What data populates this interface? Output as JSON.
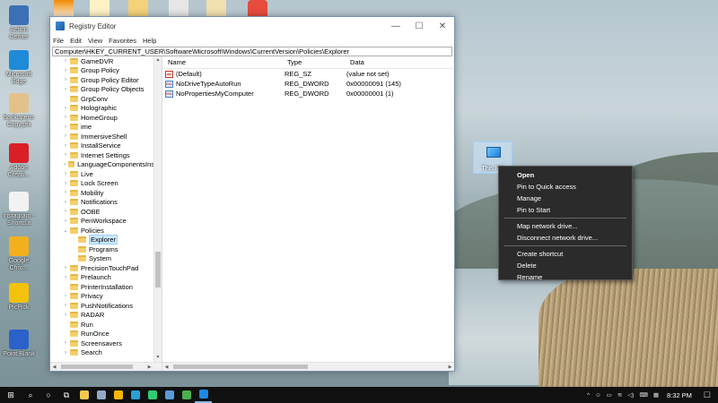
{
  "window": {
    "title": "Registry Editor",
    "controls": {
      "minimize": "—",
      "maximize": "☐",
      "close": "✕"
    },
    "menu": [
      "File",
      "Edit",
      "View",
      "Favorites",
      "Help"
    ],
    "address": "Computer\\HKEY_CURRENT_USER\\Software\\Microsoft\\Windows\\CurrentVersion\\Policies\\Explorer"
  },
  "tree": {
    "items": [
      {
        "label": "GameDVR",
        "level": 0,
        "expander": "›"
      },
      {
        "label": "Group Policy",
        "level": 0,
        "expander": "›"
      },
      {
        "label": "Group Policy Editor",
        "level": 0,
        "expander": "›"
      },
      {
        "label": "Group Policy Objects",
        "level": 0,
        "expander": "›"
      },
      {
        "label": "GrpConv",
        "level": 0,
        "expander": ""
      },
      {
        "label": "Holographic",
        "level": 0,
        "expander": "›"
      },
      {
        "label": "HomeGroup",
        "level": 0,
        "expander": "›"
      },
      {
        "label": "ime",
        "level": 0,
        "expander": "›"
      },
      {
        "label": "ImmersiveShell",
        "level": 0,
        "expander": "›"
      },
      {
        "label": "InstallService",
        "level": 0,
        "expander": "›"
      },
      {
        "label": "Internet Settings",
        "level": 0,
        "expander": "›"
      },
      {
        "label": "LanguageComponentsIns",
        "level": 0,
        "expander": "›"
      },
      {
        "label": "Live",
        "level": 0,
        "expander": "›"
      },
      {
        "label": "Lock Screen",
        "level": 0,
        "expander": "›"
      },
      {
        "label": "Mobility",
        "level": 0,
        "expander": "›"
      },
      {
        "label": "Notifications",
        "level": 0,
        "expander": "›"
      },
      {
        "label": "OOBE",
        "level": 0,
        "expander": "›"
      },
      {
        "label": "PenWorkspace",
        "level": 0,
        "expander": "›"
      },
      {
        "label": "Policies",
        "level": 0,
        "expander": "⌄"
      },
      {
        "label": "Explorer",
        "level": 1,
        "expander": "",
        "selected": true
      },
      {
        "label": "Programs",
        "level": 1,
        "expander": ""
      },
      {
        "label": "System",
        "level": 1,
        "expander": ""
      },
      {
        "label": "PrecisionTouchPad",
        "level": 0,
        "expander": "›"
      },
      {
        "label": "Prelaunch",
        "level": 0,
        "expander": "›"
      },
      {
        "label": "PrinterInstallation",
        "level": 0,
        "expander": ""
      },
      {
        "label": "Privacy",
        "level": 0,
        "expander": "›"
      },
      {
        "label": "PushNotifications",
        "level": 0,
        "expander": "›"
      },
      {
        "label": "RADAR",
        "level": 0,
        "expander": "›"
      },
      {
        "label": "Run",
        "level": 0,
        "expander": ""
      },
      {
        "label": "RunOnce",
        "level": 0,
        "expander": ""
      },
      {
        "label": "Screensavers",
        "level": 0,
        "expander": "›"
      },
      {
        "label": "Search",
        "level": 0,
        "expander": "›"
      }
    ],
    "scroll_arrows": {
      "up": "▲",
      "down": "▼",
      "left": "◀",
      "right": "▶"
    }
  },
  "values": {
    "columns": {
      "name": "Name",
      "type": "Type",
      "data": "Data"
    },
    "rows": [
      {
        "name": "(Default)",
        "type": "REG_SZ",
        "data": "(value not set)",
        "icon": "ab"
      },
      {
        "name": "NoDriveTypeAutoRun",
        "type": "REG_DWORD",
        "data": "0x00000091 (145)",
        "icon": "011"
      },
      {
        "name": "NoPropertiesMyComputer",
        "type": "REG_DWORD",
        "data": "0x00000001 (1)",
        "icon": "011"
      }
    ]
  },
  "desktop": {
    "icons": [
      {
        "label": "Action Center",
        "color": "#3b6fb6"
      },
      {
        "label": "Microsoft Edge",
        "color": "#1f8ad8"
      },
      {
        "label": "backupenc Copy.pfx",
        "color": "#e2c28a"
      },
      {
        "label": "Adobe Creati...",
        "color": "#da1f26"
      },
      {
        "label": "Instagram - Shortcut",
        "color": "#f2f2f2"
      },
      {
        "label": "Google Chro...",
        "color": "#f2b01e"
      },
      {
        "label": "PicPick",
        "color": "#f4c20d"
      },
      {
        "label": "Point Blank",
        "color": "#2a62c9"
      }
    ],
    "this_pc_label": "This PC"
  },
  "context_menu": {
    "groups": [
      [
        "Open",
        "Pin to Quick access",
        "Manage",
        "Pin to Start"
      ],
      [
        "Map network drive...",
        "Disconnect network drive..."
      ],
      [
        "Create shortcut",
        "Delete",
        "Rename"
      ]
    ]
  },
  "taskbar": {
    "start": "⊞",
    "search": "⌕",
    "cortana": "○",
    "taskview": "⧉",
    "apps": [
      "#f2c94c",
      "#8fa9c7",
      "#f7b500",
      "#2a9fd6",
      "#2ecc71",
      "#5b9bd5",
      "#4caf50",
      "#1e88e5"
    ],
    "tray_chevron": "^",
    "clock": "8:32 PM",
    "notifications": "☐"
  }
}
